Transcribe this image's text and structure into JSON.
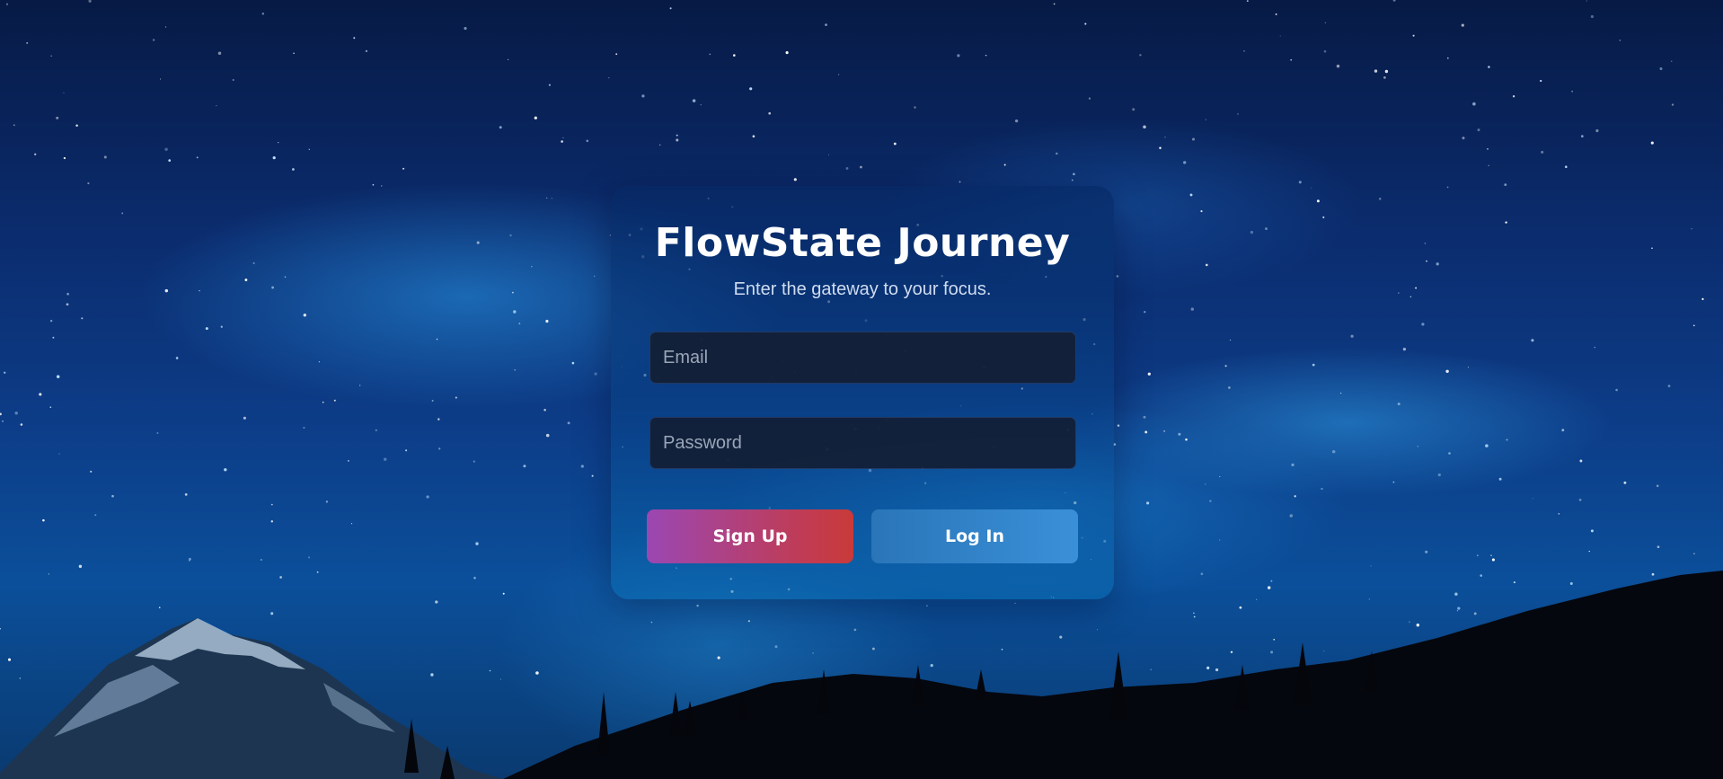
{
  "app": {
    "title": "FlowState Journey",
    "subtitle": "Enter the gateway to your focus."
  },
  "form": {
    "email": {
      "placeholder": "Email",
      "value": ""
    },
    "password": {
      "placeholder": "Password",
      "value": ""
    },
    "signup_label": "Sign Up",
    "login_label": "Log In"
  },
  "colors": {
    "sky_dark": "#071a45",
    "sky_glow": "#2a9ae6",
    "signup_gradient_start": "#9b47b3",
    "signup_gradient_end": "#c83a3a",
    "login_gradient_start": "#2a75b8",
    "login_gradient_end": "#3a90d8",
    "field_background": "#141e34"
  }
}
